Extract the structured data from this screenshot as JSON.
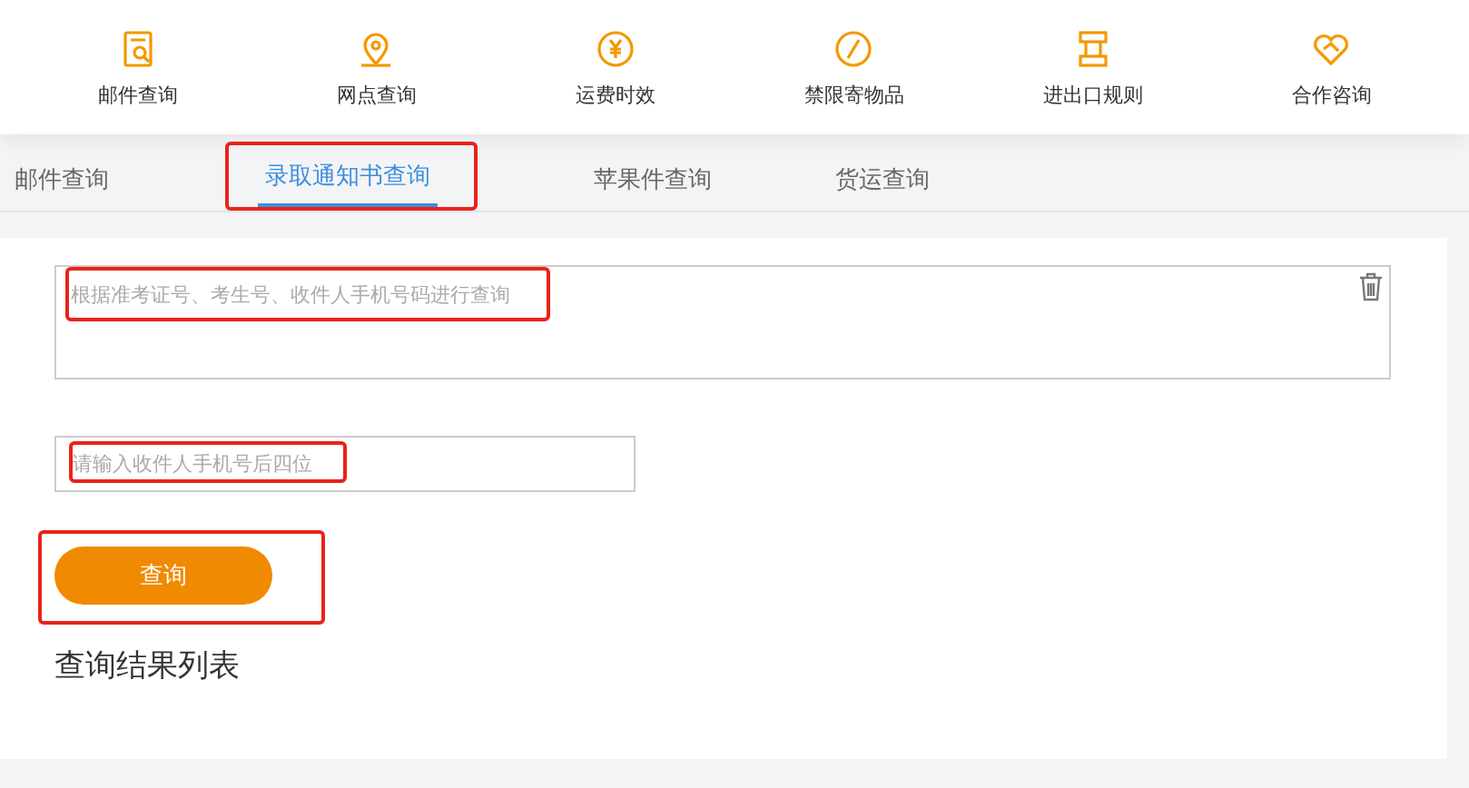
{
  "nav": [
    {
      "label": "邮件查询"
    },
    {
      "label": "网点查询"
    },
    {
      "label": "运费时效"
    },
    {
      "label": "禁限寄物品"
    },
    {
      "label": "进出口规则"
    },
    {
      "label": "合作咨询"
    }
  ],
  "tabs": [
    {
      "label": "邮件查询",
      "selected": false,
      "highlighted": false
    },
    {
      "label": "录取通知书查询",
      "selected": true,
      "highlighted": true
    },
    {
      "label": "苹果件查询",
      "selected": false,
      "highlighted": false
    },
    {
      "label": "货运查询",
      "selected": false,
      "highlighted": false
    }
  ],
  "query_box": {
    "placeholder": "根据准考证号、考生号、收件人手机号码进行查询",
    "highlighted": true
  },
  "phone_field": {
    "placeholder": "请输入收件人手机号后四位",
    "highlighted": true
  },
  "search_button": {
    "label": "查询",
    "highlighted": true
  },
  "results_title": "查询结果列表"
}
